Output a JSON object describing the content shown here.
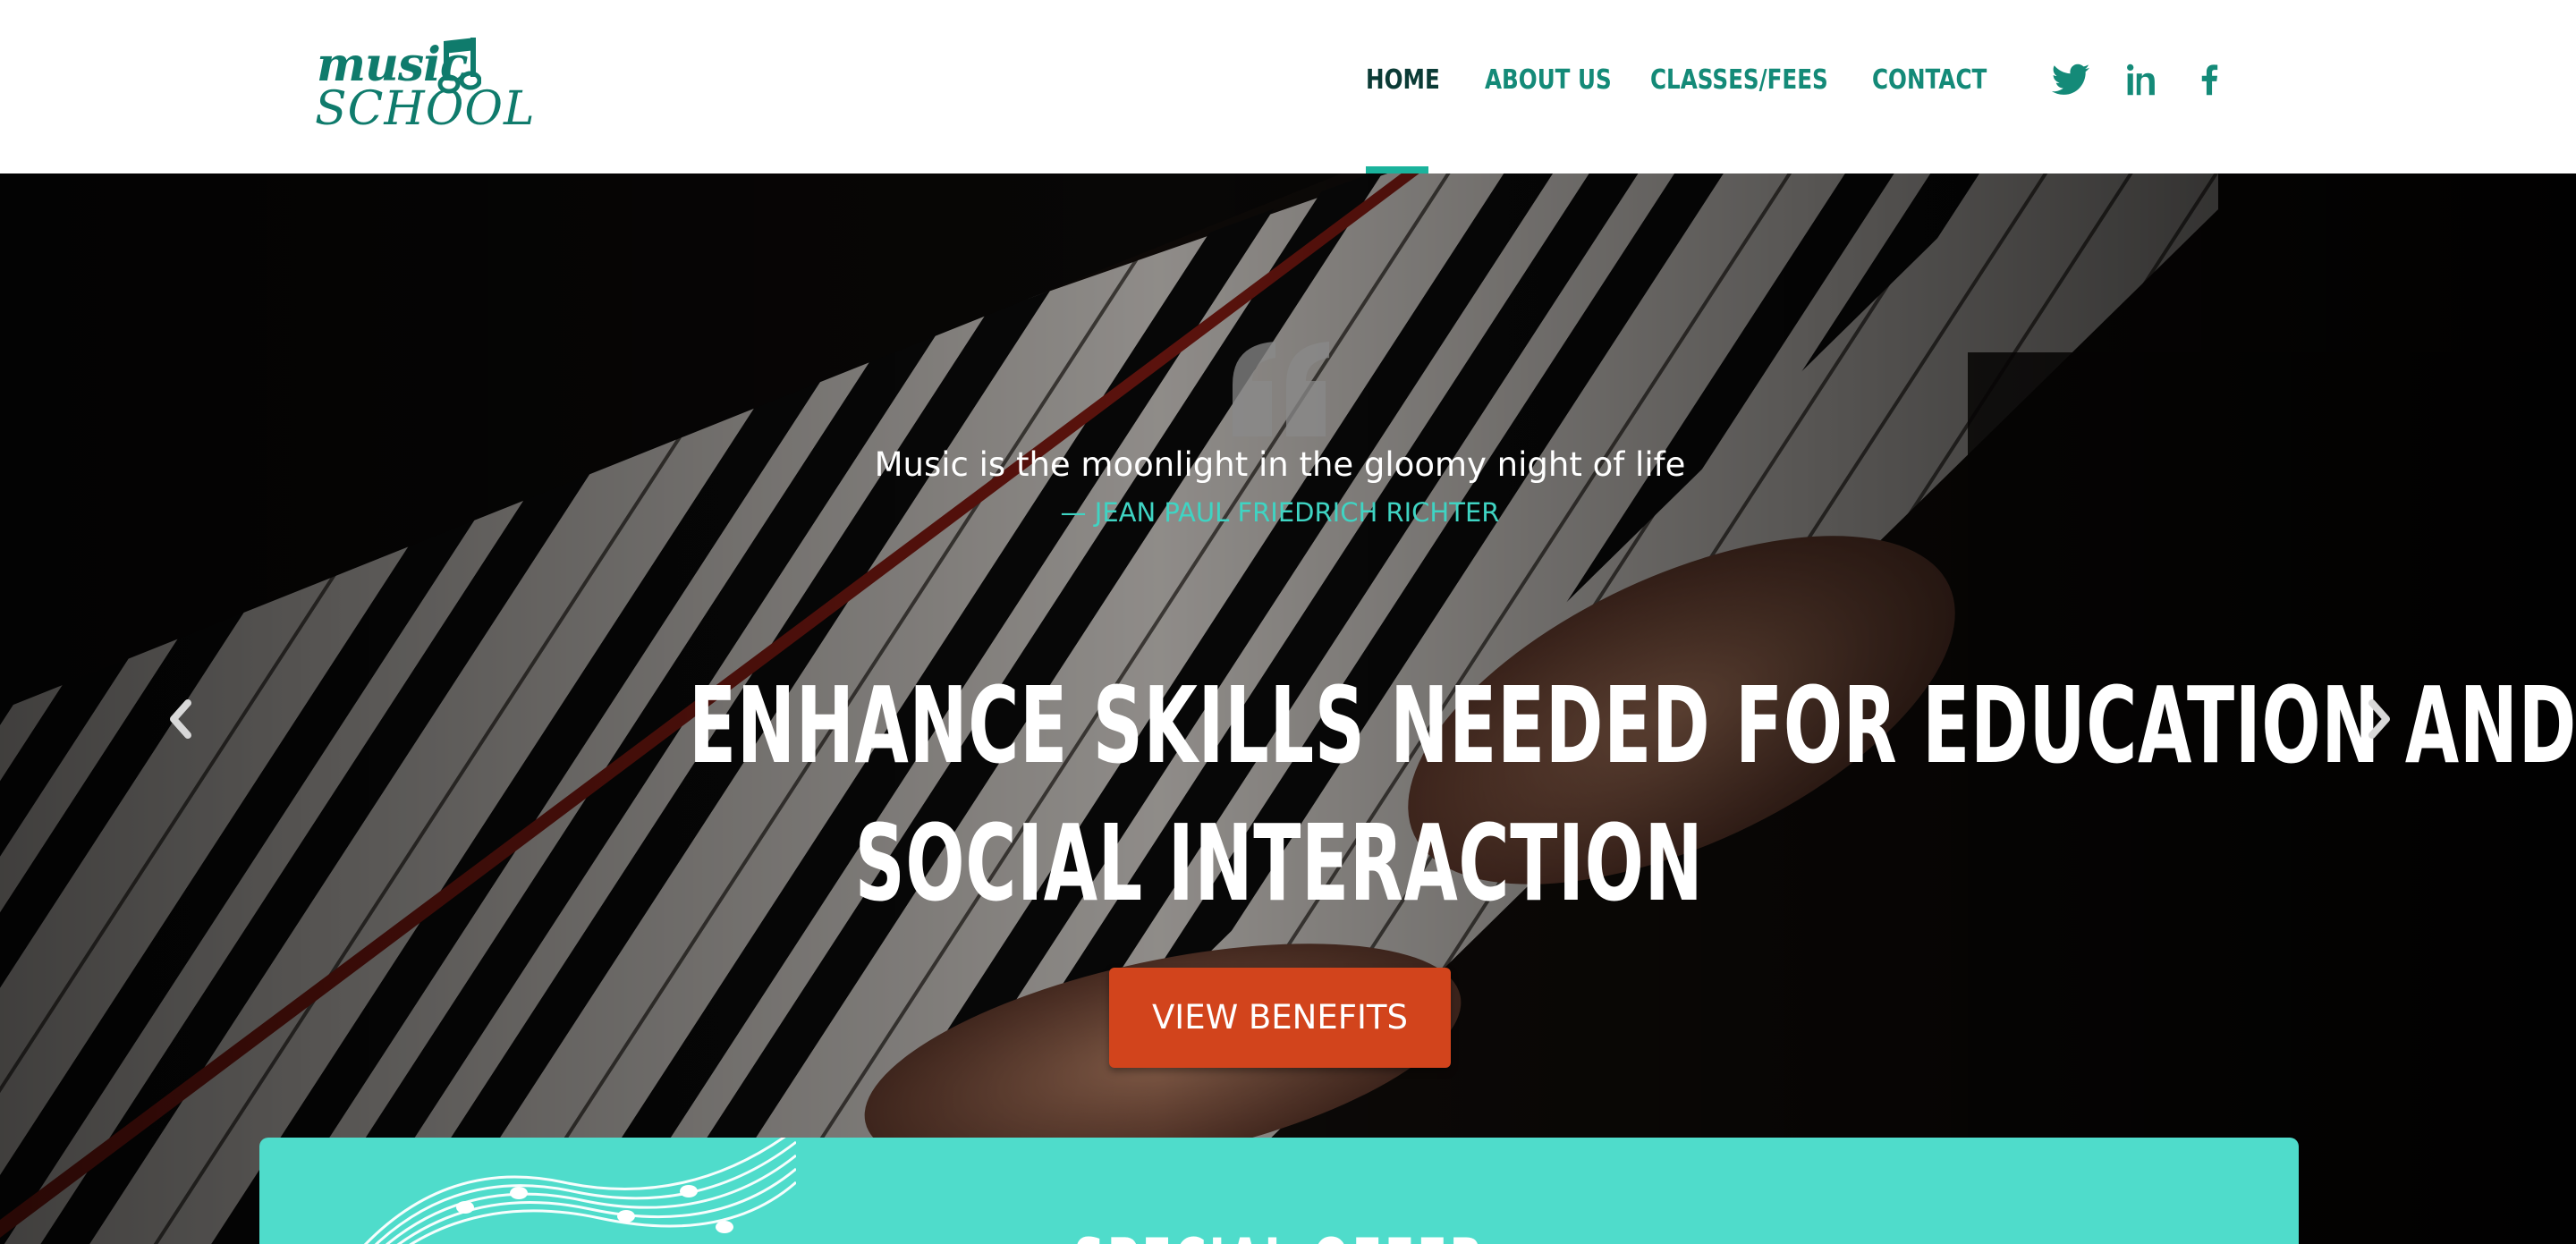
{
  "brand": {
    "logo_line1": "music",
    "logo_line2": "SCHOOL",
    "color": "#0f7b6c"
  },
  "nav": {
    "items": [
      {
        "label": "HOME",
        "active": true
      },
      {
        "label": "ABOUT US",
        "active": false
      },
      {
        "label": "CLASSES/FEES",
        "active": false
      },
      {
        "label": "CONTACT",
        "active": false
      }
    ],
    "social": [
      "twitter-icon",
      "linkedin-icon",
      "facebook-icon"
    ],
    "accent": "#1bb39c"
  },
  "hero": {
    "quote": "Music is the moonlight in the gloomy night of life",
    "author": "— JEAN PAUL FRIEDRICH RICHTER",
    "headline_line1": "ENHANCE SKILLS NEEDED FOR EDUCATION AND",
    "headline_line2": "SOCIAL INTERACTION",
    "cta_label": "VIEW BENEFITS",
    "cta_color": "#d2441c",
    "carousel_controls": [
      "chevron-left-icon",
      "chevron-right-icon"
    ]
  },
  "offer": {
    "title": "SPECIAL OFFER",
    "background": "#4fdccb"
  }
}
